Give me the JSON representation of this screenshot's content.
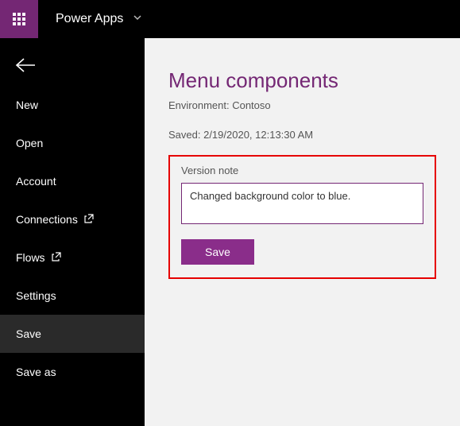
{
  "brand": {
    "name": "Power Apps"
  },
  "sidebar": {
    "items": [
      {
        "label": "New"
      },
      {
        "label": "Open"
      },
      {
        "label": "Account"
      },
      {
        "label": "Connections",
        "external": true
      },
      {
        "label": "Flows",
        "external": true
      },
      {
        "label": "Settings"
      },
      {
        "label": "Save",
        "active": true
      },
      {
        "label": "Save as"
      }
    ]
  },
  "main": {
    "title": "Menu components",
    "env_label": "Environment: Contoso",
    "saved_label": "Saved: 2/19/2020, 12:13:30 AM",
    "note_field_label": "Version note",
    "note_value": "Changed background color to blue.",
    "save_button_label": "Save"
  },
  "colors": {
    "accent": "#742774",
    "highlight": "#e60000"
  }
}
